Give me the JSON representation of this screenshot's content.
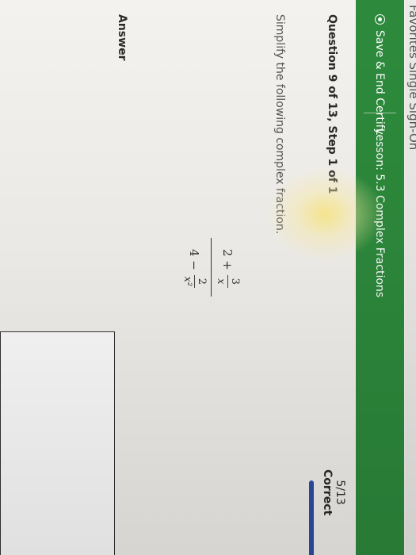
{
  "top_strip_text": "Favorites Single Sign-On",
  "header": {
    "save_label": "Save & End Certify",
    "lesson_label": "Lesson: 5.3 Complex Fractions"
  },
  "question": {
    "label": "Question 9 of 13, Step 1 of 1",
    "score": "5/13",
    "score_status": "Correct",
    "prompt": "Simplify the following complex fraction.",
    "progress_fraction": 0.38
  },
  "fraction": {
    "numerator_whole": "2 +",
    "numerator_top": "3",
    "numerator_bottom": "x",
    "denominator_whole": "4 −",
    "denominator_top": "2",
    "denominator_bottom": "x²"
  },
  "answer": {
    "label": "Answer"
  },
  "colors": {
    "banner": "#2d8a3c",
    "progress": "#2e4fa6"
  }
}
